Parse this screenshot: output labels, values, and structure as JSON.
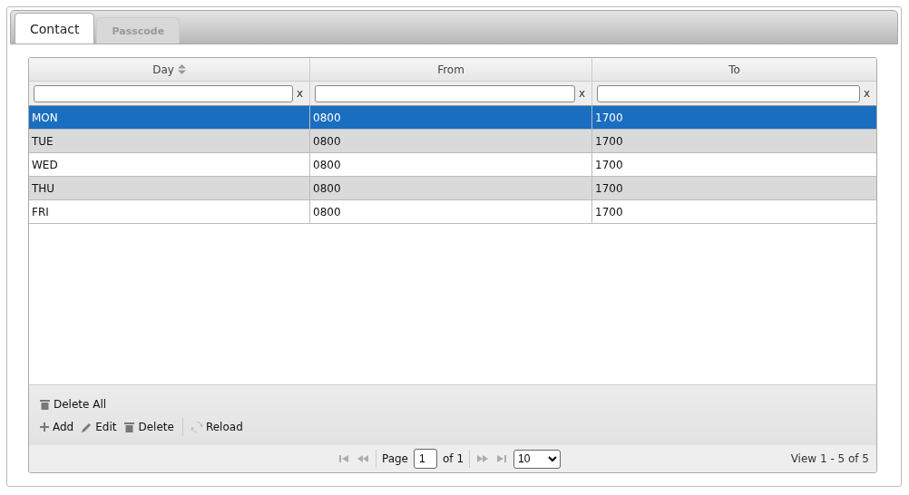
{
  "tabs": [
    {
      "label": "Contact",
      "selected": true
    },
    {
      "label": "Passcode",
      "selected": false
    }
  ],
  "table": {
    "columns": [
      {
        "label": "Day",
        "sortable": true,
        "filter_clear": "x"
      },
      {
        "label": "From",
        "sortable": false,
        "filter_clear": "x"
      },
      {
        "label": "To",
        "sortable": false,
        "filter_clear": "x"
      }
    ],
    "rows": [
      {
        "cells": [
          "MON",
          "0800",
          "1700"
        ],
        "selected": true
      },
      {
        "cells": [
          "TUE",
          "0800",
          "1700"
        ],
        "selected": false
      },
      {
        "cells": [
          "WED",
          "0800",
          "1700"
        ],
        "selected": false
      },
      {
        "cells": [
          "THU",
          "0800",
          "1700"
        ],
        "selected": false
      },
      {
        "cells": [
          "FRI",
          "0800",
          "1700"
        ],
        "selected": false
      }
    ]
  },
  "toolbar": {
    "top": [
      {
        "kind": "trash",
        "label": "Delete All"
      }
    ],
    "bottom": [
      {
        "kind": "plus",
        "label": "Add"
      },
      {
        "kind": "pencil",
        "label": "Edit"
      },
      {
        "kind": "trash",
        "label": "Delete"
      },
      {
        "kind": "separator"
      },
      {
        "kind": "reload",
        "label": "Reload"
      }
    ]
  },
  "pager": {
    "first_disabled": true,
    "prev_disabled": true,
    "next_disabled": true,
    "last_disabled": true,
    "page_label": "Page",
    "page": "1",
    "of_label": "of 1",
    "page_size": "10",
    "view": "View 1 - 5 of 5"
  }
}
